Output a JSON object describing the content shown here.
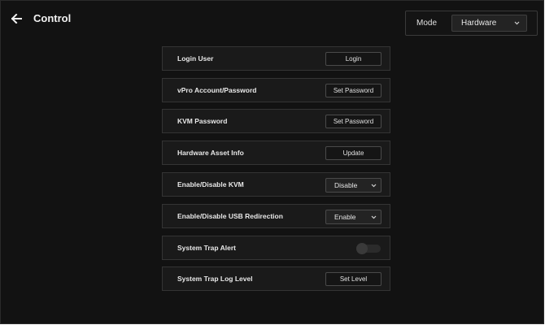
{
  "header": {
    "back_icon": "arrow-left-icon",
    "title": "Control"
  },
  "mode": {
    "label": "Mode",
    "selected": "Hardware",
    "icon": "chevron-down-icon"
  },
  "rows": [
    {
      "label": "Login User",
      "control": "button",
      "button_label": "Login"
    },
    {
      "label": "vPro Account/Password",
      "control": "button",
      "button_label": "Set Password"
    },
    {
      "label": "KVM Password",
      "control": "button",
      "button_label": "Set Password"
    },
    {
      "label": "Hardware Asset Info",
      "control": "button",
      "button_label": "Update"
    },
    {
      "label": "Enable/Disable KVM",
      "control": "select",
      "selected": "Disable"
    },
    {
      "label": "Enable/Disable USB Redirection",
      "control": "select",
      "selected": "Enable"
    },
    {
      "label": "System Trap Alert",
      "control": "toggle",
      "toggle_on": false
    },
    {
      "label": "System Trap Log Level",
      "control": "button",
      "button_label": "Set Level"
    }
  ],
  "colors": {
    "background": "#121212",
    "row_background": "#1a1a1a",
    "border": "#343434",
    "text": "#e6e6e6"
  }
}
